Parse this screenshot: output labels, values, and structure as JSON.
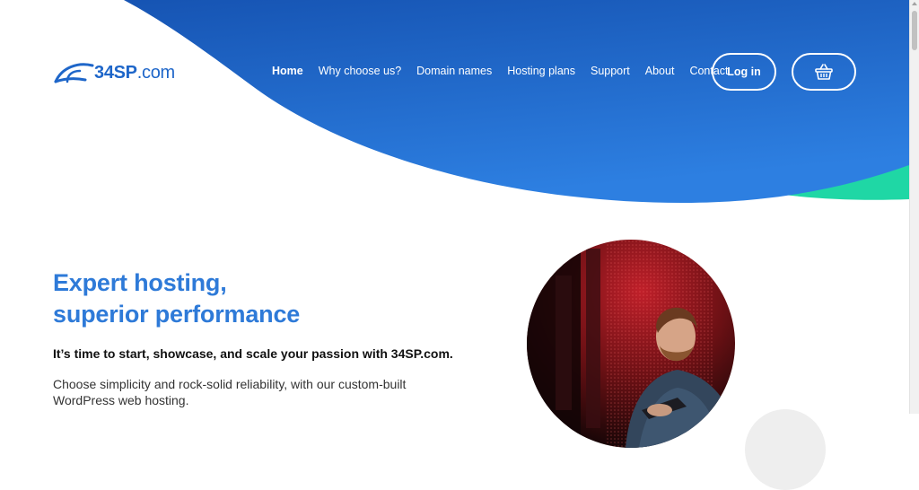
{
  "brand": {
    "name_bold": "34SP",
    "name_suffix": ".com",
    "color": "#1e66c9"
  },
  "colors": {
    "header_blue": "#1958b7",
    "header_blue_light": "#2c7ee0",
    "accent_green": "#1fd7a5",
    "heading_blue": "#2e7ad8"
  },
  "nav": {
    "items": [
      {
        "label": "Home",
        "active": true
      },
      {
        "label": "Why choose us?"
      },
      {
        "label": "Domain names"
      },
      {
        "label": "Hosting plans"
      },
      {
        "label": "Support"
      },
      {
        "label": "About"
      },
      {
        "label": "Contact"
      }
    ],
    "login_label": "Log in",
    "cart_icon": "basket-icon"
  },
  "hero": {
    "title_line1": "Expert hosting,",
    "title_line2": "superior performance",
    "lead": "It’s time to start, showcase, and scale your passion with 34SP.com.",
    "body": "Choose simplicity and rock-solid reliability, with our custom-built WordPress web hosting."
  }
}
